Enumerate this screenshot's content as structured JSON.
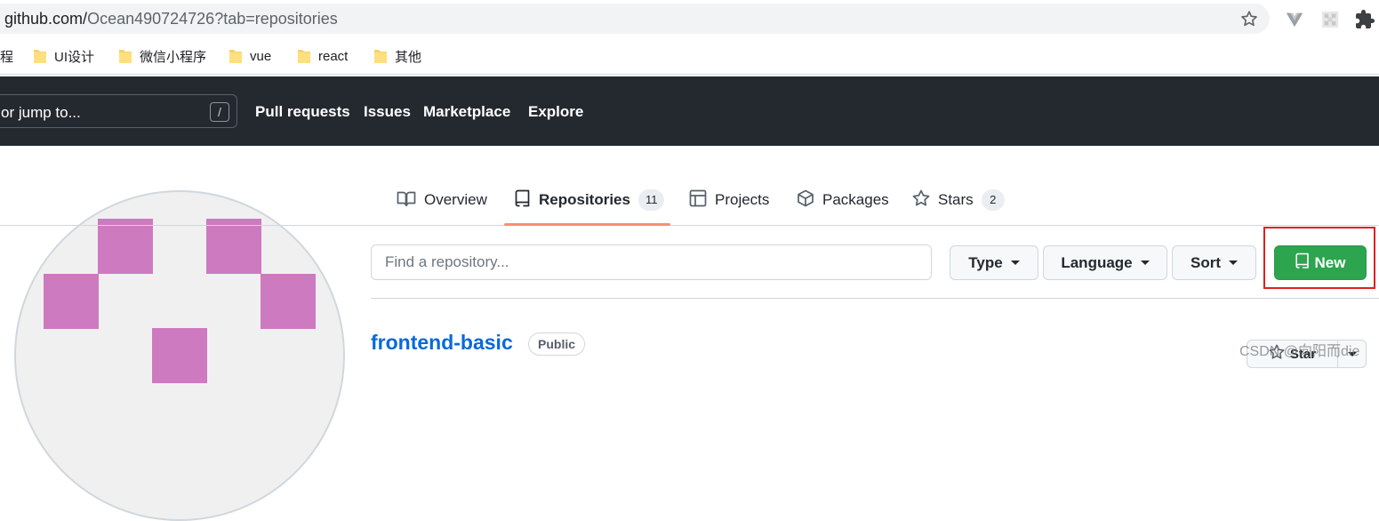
{
  "browser": {
    "url_host": "github.com/",
    "url_rest": "Ocean490724726?tab=repositories",
    "icons": [
      "star-icon",
      "vue-devtools-icon",
      "extension-grid-icon",
      "puzzle-extension-icon"
    ]
  },
  "bookmarks": [
    {
      "label": "程"
    },
    {
      "label": "UI设计"
    },
    {
      "label": "微信小程序"
    },
    {
      "label": "vue"
    },
    {
      "label": "react"
    },
    {
      "label": "其他"
    }
  ],
  "header": {
    "search_placeholder": "or jump to...",
    "search_key": "/",
    "nav": [
      "Pull requests",
      "Issues",
      "Marketplace",
      "Explore"
    ]
  },
  "tabs": [
    {
      "label": "Overview",
      "icon": "book-icon"
    },
    {
      "label": "Repositories",
      "count": "11",
      "icon": "repo-icon",
      "active": true
    },
    {
      "label": "Projects",
      "icon": "table-icon"
    },
    {
      "label": "Packages",
      "icon": "package-icon"
    },
    {
      "label": "Stars",
      "count": "2",
      "icon": "star-icon"
    }
  ],
  "filters": {
    "search_placeholder": "Find a repository...",
    "type_label": "Type",
    "language_label": "Language",
    "sort_label": "Sort",
    "new_label": "New"
  },
  "repo": {
    "name": "frontend-basic",
    "visibility": "Public",
    "star_label": "Star"
  },
  "watermark": "CSDN @向阳而die",
  "colors": {
    "header_bg": "#24292f",
    "accent_underline": "#fd8c73",
    "new_button": "#2da44e",
    "link": "#0969da",
    "avatar_pixel": "#ce7ac0",
    "highlight": "#e0201d"
  }
}
